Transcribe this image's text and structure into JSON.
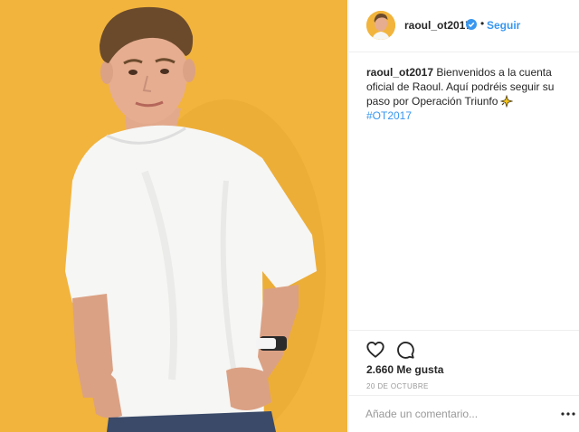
{
  "post": {
    "username": "raoul_ot2017",
    "follow_label": "Seguir",
    "separator": "•",
    "caption_user": "raoul_ot2017",
    "caption_text": " Bienvenidos a la cuenta oficial de Raoul. Aquí podréis seguir su paso por Operación Triunfo",
    "hashtag": "#OT2017",
    "likes": "2.660 Me gusta",
    "date": "20 DE OCTUBRE",
    "comment_placeholder": "Añade un comentario..."
  },
  "icons": {
    "verified": "verified-badge-icon",
    "sparkle": "sparkle-star-icon",
    "heart": "heart-icon",
    "comment": "comment-bubble-icon",
    "more": "more-dots-icon"
  },
  "colors": {
    "link_blue": "#3897f0",
    "photo_background": "#f2b43c",
    "text": "#262626",
    "muted": "#999999"
  }
}
